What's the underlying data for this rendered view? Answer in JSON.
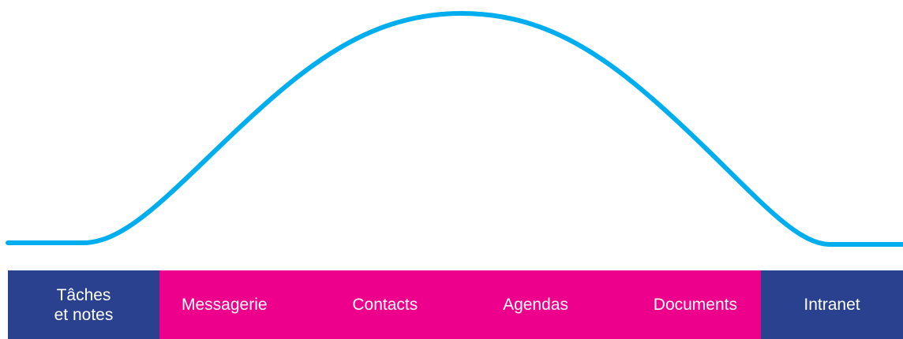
{
  "colors": {
    "curve": "#00aeef",
    "blue": "#2a4190",
    "pink": "#ec008c",
    "text": "#ffffff"
  },
  "bar": {
    "left_label_line1": "Tâches",
    "left_label_line2": "et notes",
    "middle_labels": [
      "Messagerie",
      "Contacts",
      "Agendas",
      "Documents"
    ],
    "right_label": "Intranet"
  }
}
